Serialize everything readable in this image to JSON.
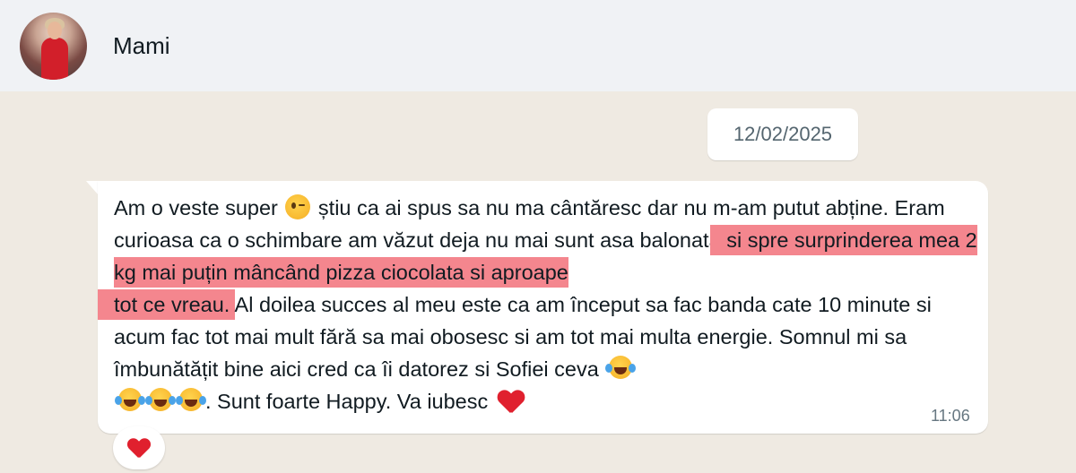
{
  "header": {
    "contact_name": "Mami",
    "avatar": "avatar-photo"
  },
  "date_chip": "12/02/2025",
  "message": {
    "part1": "Am o veste super ",
    "emoji1": "winking-face",
    "part2": " știu ca ai spus sa nu ma cântăresc dar nu m-am putut abține. Eram curioasa ca o schimbare am văzut deja nu mai sunt asa balonata ",
    "highlight1": "si spre surprinderea mea 2 kg mai puțin mâncând pizza ciocolata si aproape",
    "highlight2": "tot ce vreau.",
    "part3": " Al doilea succes al meu este ca am început sa fac banda cate 10 minute si acum fac tot mai mult fără sa mai obosesc si am tot mai multa energie. Somnul mi sa îmbunătățit bine aici cred ca îi datorez si Sofiei ceva ",
    "emoji_laugh": "face-with-tears-of-joy",
    "part4": ". Sunt foarte Happy. Va iubesc ",
    "emoji_heart": "red-heart",
    "time": "11:06",
    "highlight_color": "#f4868e"
  },
  "reaction": {
    "emoji": "red-heart"
  },
  "colors": {
    "background": "#efeae2",
    "header": "#f0f2f5",
    "bubble": "#ffffff",
    "timestamp": "#667781"
  }
}
